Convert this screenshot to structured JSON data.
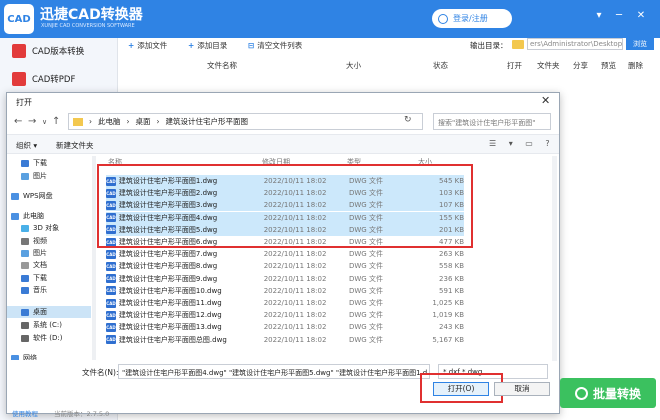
{
  "app": {
    "logo_text": "CAD",
    "title": "迅捷CAD转换器",
    "subtitle": "XUNJIE CAD CONVERSION SOFTWARE",
    "login_label": "登录/注册",
    "window_buttons": [
      "▾",
      "─",
      "✕"
    ]
  },
  "sidebar": {
    "items": [
      {
        "label": "CAD版本转换",
        "color": "#e23b3b"
      },
      {
        "label": "CAD转PDF",
        "color": "#e23b3b"
      }
    ]
  },
  "toolbar": {
    "add_file": "添加文件",
    "add_dir": "添加目录",
    "clear_list": "清空文件列表",
    "output_dir_label": "输出目录：",
    "output_path": "ers\\Administrator\\Desktop",
    "browse": "浏览"
  },
  "list_columns": [
    "文件名称",
    "大小",
    "状态",
    "打开",
    "文件夹",
    "分享",
    "预览",
    "删除"
  ],
  "dialog": {
    "title": "打开",
    "close": "✕",
    "nav": [
      "←",
      "→",
      "∨",
      "↑"
    ],
    "breadcrumb": [
      "此电脑",
      "桌面",
      "建筑设计住宅户形平面图"
    ],
    "refresh": "↻",
    "search_placeholder": "搜索\"建筑设计住宅户形平面图\"",
    "organize": "组织 ▾",
    "new_folder": "新建文件夹",
    "view_icons": "☰ ▾ ▭ ?",
    "tree": [
      {
        "label": "下载",
        "color": "#3a7bd5"
      },
      {
        "label": "图片",
        "color": "#5aa0e0"
      },
      {
        "label": "WPS网盘",
        "color": "#4a90e2"
      },
      {
        "label": "此电脑",
        "color": "#4a90e2"
      },
      {
        "label": "3D 对象",
        "color": "#4ab0e8"
      },
      {
        "label": "视频",
        "color": "#777"
      },
      {
        "label": "图片",
        "color": "#5aa0e0"
      },
      {
        "label": "文档",
        "color": "#999"
      },
      {
        "label": "下载",
        "color": "#3a7bd5"
      },
      {
        "label": "音乐",
        "color": "#3a7bd5"
      },
      {
        "label": "桌面",
        "color": "#3a7bd5"
      },
      {
        "label": "系统 (C:)",
        "color": "#666"
      },
      {
        "label": "软件 (D:)",
        "color": "#666"
      },
      {
        "label": "网络",
        "color": "#4a90e2"
      }
    ],
    "columns": [
      "名称",
      "修改日期",
      "类型",
      "大小"
    ],
    "files": [
      {
        "name": "建筑设计住宅户形平面图1.dwg",
        "date": "2022/10/11 18:02",
        "type": "DWG 文件",
        "size": "545 KB",
        "selected": true
      },
      {
        "name": "建筑设计住宅户形平面图2.dwg",
        "date": "2022/10/11 18:02",
        "type": "DWG 文件",
        "size": "103 KB",
        "selected": true
      },
      {
        "name": "建筑设计住宅户形平面图3.dwg",
        "date": "2022/10/11 18:02",
        "type": "DWG 文件",
        "size": "107 KB",
        "selected": true
      },
      {
        "name": "建筑设计住宅户形平面图4.dwg",
        "date": "2022/10/11 18:02",
        "type": "DWG 文件",
        "size": "155 KB",
        "selected": true
      },
      {
        "name": "建筑设计住宅户形平面图5.dwg",
        "date": "2022/10/11 18:02",
        "type": "DWG 文件",
        "size": "201 KB",
        "selected": true
      },
      {
        "name": "建筑设计住宅户形平面图6.dwg",
        "date": "2022/10/11 18:02",
        "type": "DWG 文件",
        "size": "477 KB",
        "selected": false
      },
      {
        "name": "建筑设计住宅户形平面图7.dwg",
        "date": "2022/10/11 18:02",
        "type": "DWG 文件",
        "size": "263 KB",
        "selected": false
      },
      {
        "name": "建筑设计住宅户形平面图8.dwg",
        "date": "2022/10/11 18:02",
        "type": "DWG 文件",
        "size": "558 KB",
        "selected": false
      },
      {
        "name": "建筑设计住宅户形平面图9.dwg",
        "date": "2022/10/11 18:02",
        "type": "DWG 文件",
        "size": "236 KB",
        "selected": false
      },
      {
        "name": "建筑设计住宅户形平面图10.dwg",
        "date": "2022/10/11 18:02",
        "type": "DWG 文件",
        "size": "591 KB",
        "selected": false
      },
      {
        "name": "建筑设计住宅户形平面图11.dwg",
        "date": "2022/10/11 18:02",
        "type": "DWG 文件",
        "size": "1,025 KB",
        "selected": false
      },
      {
        "name": "建筑设计住宅户形平面图12.dwg",
        "date": "2022/10/11 18:02",
        "type": "DWG 文件",
        "size": "1,019 KB",
        "selected": false
      },
      {
        "name": "建筑设计住宅户形平面图13.dwg",
        "date": "2022/10/11 18:02",
        "type": "DWG 文件",
        "size": "243 KB",
        "selected": false
      },
      {
        "name": "建筑设计住宅户形平面图总图.dwg",
        "date": "2022/10/11 18:02",
        "type": "DWG 文件",
        "size": "5,167 KB",
        "selected": false
      }
    ],
    "file_icon_text": "CAD",
    "filename_label": "文件名(N):",
    "filename_value": "\"建筑设计住宅户形平面图4.dwg\" \"建筑设计住宅户形平面图5.dwg\" \"建筑设计住宅户形平面图1.d",
    "filetype_value": "*.dxf *.dwg",
    "open_button": "打开(O)",
    "cancel_button": "取消"
  },
  "batch_convert": "批量转换",
  "footer": {
    "help": "使用教程",
    "version": "当前版本：2.7.5.0"
  }
}
